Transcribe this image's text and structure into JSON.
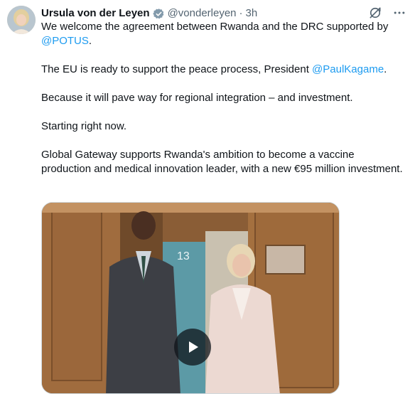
{
  "author": {
    "name": "Ursula von der Leyen",
    "handle": "@vonderleyen",
    "separator": "·",
    "time": "3h",
    "avatar_icon": "profile-photo",
    "badge_icon": "verified-gray-badge-icon"
  },
  "header_actions": [
    "grok-icon",
    "more-icon"
  ],
  "tweet": {
    "line1_a": "We welcome the agreement between Rwanda and the DRC supported by",
    "mention_potus": "@POTUS",
    "line1_end": ".",
    "p2_a": "The EU is ready to support the peace process, President ",
    "mention_kagame": "@PaulKagame",
    "p2_end": ".",
    "p3": "Because it will pave way for regional integration – and investment.",
    "p4": "Starting right now.",
    "p5": "Global Gateway supports Rwanda's ambition to become a vaccine production and medical innovation leader, with a new €95 million investment."
  },
  "media": {
    "type": "video",
    "sign_number": "13",
    "play_icon": "play-icon"
  },
  "colors": {
    "link": "#1d9bf0",
    "text": "#0f1419",
    "secondary": "#536471"
  }
}
